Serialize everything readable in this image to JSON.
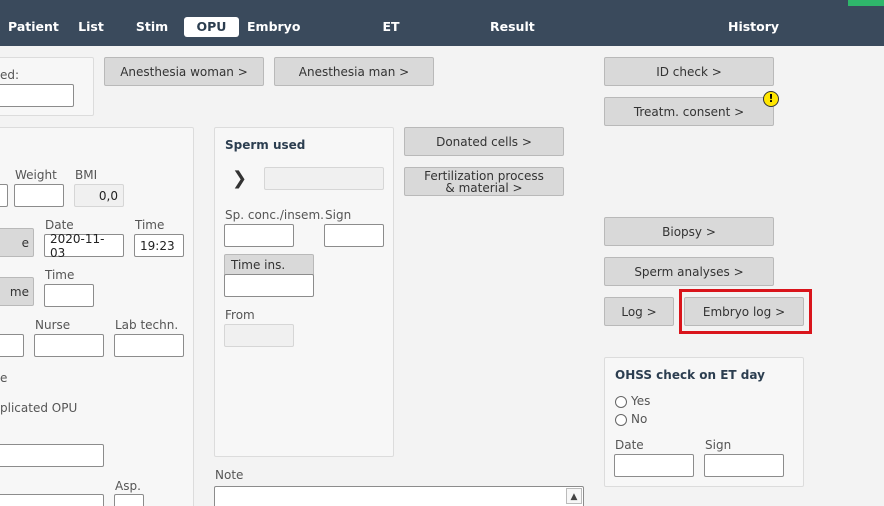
{
  "nav": {
    "tabs": [
      "Patient",
      "List",
      "Stim",
      "OPU",
      "Embryo",
      "ET",
      "Result",
      "History"
    ]
  },
  "top_panel": {
    "label_used": "ed:"
  },
  "buttons": {
    "anesthesia_woman": "Anesthesia woman >",
    "anesthesia_man": "Anesthesia man >",
    "id_check": "ID check >",
    "treatm_consent": "Treatm. consent >",
    "donated_cells": "Donated cells >",
    "fertilization": "Fertilization process & material >",
    "biopsy": "Biopsy >",
    "sperm_analyses": "Sperm analyses >",
    "log": "Log >",
    "embryo_log": "Embryo log >",
    "left_btn_1": "e",
    "left_btn_2": "me",
    "time_ins": "Time ins."
  },
  "warning": "!",
  "left_panel": {
    "weight": "Weight",
    "bmi": "BMI",
    "bmi_value": "0,0",
    "date": "Date",
    "date_value": "2020-11-03",
    "time": "Time",
    "time_value": "19:23",
    "time2": "Time",
    "nurse": "Nurse",
    "lab_techn": "Lab techn.",
    "e_label": "e",
    "complicated": "plicated OPU",
    "asp": "Asp."
  },
  "sperm_panel": {
    "title": "Sperm used",
    "conc": "Sp. conc./insem.",
    "sign": "Sign",
    "from": "From"
  },
  "note": {
    "label": "Note"
  },
  "ohss": {
    "title": "OHSS check on ET day",
    "yes": "Yes",
    "no": "No",
    "date": "Date",
    "sign": "Sign"
  }
}
